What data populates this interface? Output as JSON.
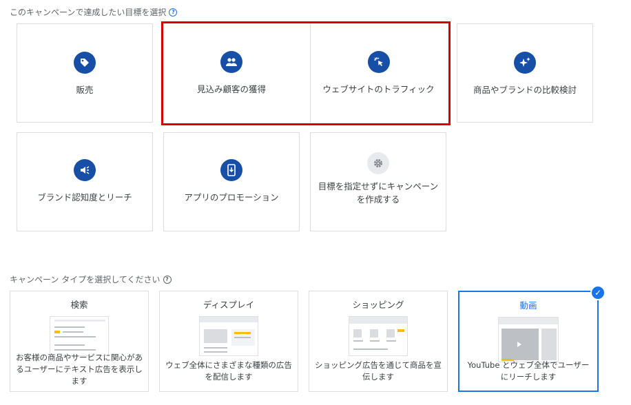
{
  "goals_section": {
    "title": "このキャンペーンで達成したい目標を選択",
    "help_icon": "help-circle-icon"
  },
  "goals": [
    {
      "label": "販売",
      "icon": "tag-icon"
    },
    {
      "label": "見込み顧客の獲得",
      "icon": "people-icon"
    },
    {
      "label": "ウェブサイトのトラフィック",
      "icon": "cursor-click-icon"
    },
    {
      "label": "商品やブランドの比較検討",
      "icon": "sparkle-icon"
    },
    {
      "label": "ブランド認知度とリーチ",
      "icon": "megaphone-icon"
    },
    {
      "label": "アプリのプロモーション",
      "icon": "phone-download-icon"
    },
    {
      "label": "目標を指定せずにキャンペーンを作成する",
      "icon": "gear-icon"
    }
  ],
  "type_section": {
    "title": "キャンペーン タイプを選択してください",
    "help_icon": "help-circle-icon"
  },
  "campaign_types": [
    {
      "name": "検索",
      "desc": "お客様の商品やサービスに関心があるユーザーにテキスト広告を表示します",
      "selected": false
    },
    {
      "name": "ディスプレイ",
      "desc": "ウェブ全体にさまざまな種類の広告を配信します",
      "selected": false
    },
    {
      "name": "ショッピング",
      "desc": "ショッピング広告を通じて商品を宣伝します",
      "selected": false
    },
    {
      "name": "動画",
      "desc": "YouTube とウェブ全体でユーザーにリーチします",
      "selected": true
    }
  ],
  "colors": {
    "accent": "#1a73e8",
    "icon_bg": "#174ea6",
    "highlight": "#d50000"
  }
}
